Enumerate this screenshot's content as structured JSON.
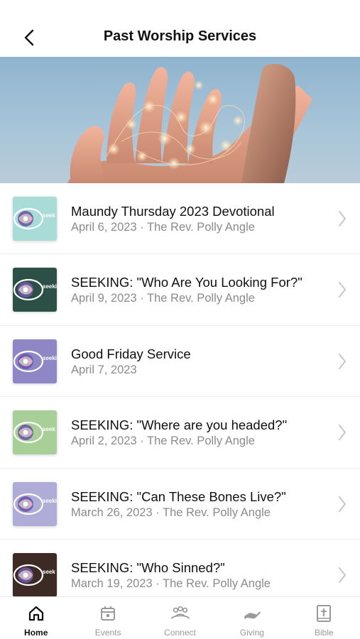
{
  "header": {
    "title": "Past Worship Services",
    "back_icon": "chevron-left-icon"
  },
  "hero": {
    "image": "hands-holding-fairy-lights"
  },
  "services": [
    {
      "title": "Maundy Thursday 2023 Devotional",
      "subtitle": "April 6, 2023 · The Rev. Polly Angle",
      "thumb_color": "#a9dcd6",
      "thumb_text": "seek"
    },
    {
      "title": "SEEKING: \"Who Are You Looking For?\"",
      "subtitle": "April 9, 2023 · The Rev. Polly Angle",
      "thumb_color": "#2c4f46",
      "thumb_text": "seeki"
    },
    {
      "title": "Good Friday Service",
      "subtitle": "April 7, 2023",
      "thumb_color": "#8f86c6",
      "thumb_text": "seeki"
    },
    {
      "title": "SEEKING: \"Where are you headed?\"",
      "subtitle": "April 2, 2023 · The Rev. Polly Angle",
      "thumb_color": "#a8cf98",
      "thumb_text": "seek"
    },
    {
      "title": "SEEKING: \"Can These Bones Live?\"",
      "subtitle": "March 26, 2023 · The Rev. Polly Angle",
      "thumb_color": "#b0acd8",
      "thumb_text": "seeki"
    },
    {
      "title": "SEEKING: \"Who Sinned?\"",
      "subtitle": "March 19, 2023 · The Rev. Polly Angle",
      "thumb_color": "#3e2a24",
      "thumb_text": "seek"
    }
  ],
  "tabbar": {
    "items": [
      {
        "label": "Home",
        "icon": "home-icon",
        "active": true
      },
      {
        "label": "Events",
        "icon": "calendar-icon",
        "active": false
      },
      {
        "label": "Connect",
        "icon": "people-icon",
        "active": false
      },
      {
        "label": "Giving",
        "icon": "giving-hand-icon",
        "active": false
      },
      {
        "label": "Bible",
        "icon": "bible-icon",
        "active": false
      }
    ]
  },
  "colors": {
    "text": "#111111",
    "subtext": "#8b8b8b",
    "chevron": "#c7c7cc",
    "tab_inactive": "#9a9a9a"
  }
}
